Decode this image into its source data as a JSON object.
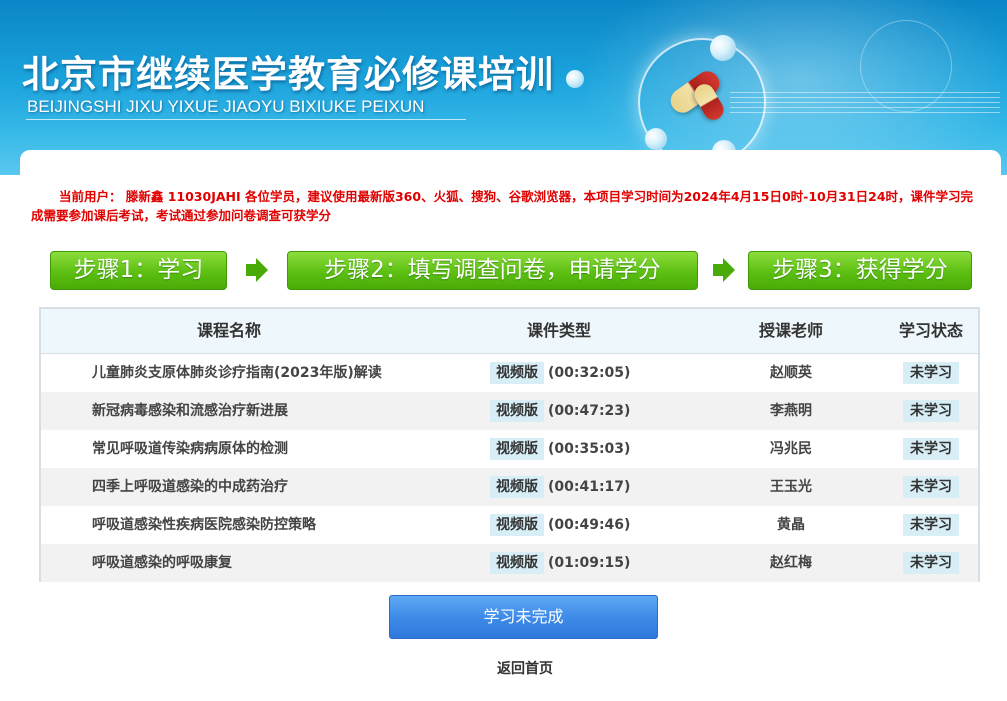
{
  "banner": {
    "title": "北京市继续医学教育必修课培训",
    "subtitle": "BEIJINGSHI JIXU YIXUE JIAOYU BIXIUKE PEIXUN"
  },
  "notice": {
    "text": "当前用户： 滕新鑫 11030JAHI  各位学员，建议使用最新版360、火狐、搜狗、谷歌浏览器，本项目学习时间为2024年4月15日0时-10月31日24时，课件学习完成需要参加课后考试，考试通过参加问卷调查可获学分"
  },
  "steps": [
    {
      "label": "步骤1：学习"
    },
    {
      "label": "步骤2：填写调查问卷，申请学分"
    },
    {
      "label": "步骤3：获得学分"
    }
  ],
  "table": {
    "headers": {
      "name": "课程名称",
      "type": "课件类型",
      "teacher": "授课老师",
      "status": "学习状态"
    },
    "rows": [
      {
        "name": "儿童肺炎支原体肺炎诊疗指南(2023年版)解读",
        "type": "视频版",
        "duration": "(00:32:05)",
        "teacher": "赵顺英",
        "status": "未学习"
      },
      {
        "name": "新冠病毒感染和流感治疗新进展",
        "type": "视频版",
        "duration": "(00:47:23)",
        "teacher": "李燕明",
        "status": "未学习"
      },
      {
        "name": "常见呼吸道传染病病原体的检测",
        "type": "视频版",
        "duration": "(00:35:03)",
        "teacher": "冯兆民",
        "status": "未学习"
      },
      {
        "name": "四季上呼吸道感染的中成药治疗",
        "type": "视频版",
        "duration": "(00:41:17)",
        "teacher": "王玉光",
        "status": "未学习"
      },
      {
        "name": "呼吸道感染性疾病医院感染防控策略",
        "type": "视频版",
        "duration": "(00:49:46)",
        "teacher": "黄晶",
        "status": "未学习"
      },
      {
        "name": "呼吸道感染的呼吸康复",
        "type": "视频版",
        "duration": "(01:09:15)",
        "teacher": "赵红梅",
        "status": "未学习"
      }
    ]
  },
  "actions": {
    "study_button": "学习未完成",
    "back_home": "返回首页"
  },
  "colors": {
    "banner_blue": "#1ba3dc",
    "step_green": "#5cbf12",
    "notice_red": "#e00000",
    "button_blue": "#3e8be8",
    "badge_bg": "#d7eef7"
  },
  "icons": {
    "step_arrow": "arrow-right-icon",
    "banner_art": "capsule-pill-icon"
  }
}
